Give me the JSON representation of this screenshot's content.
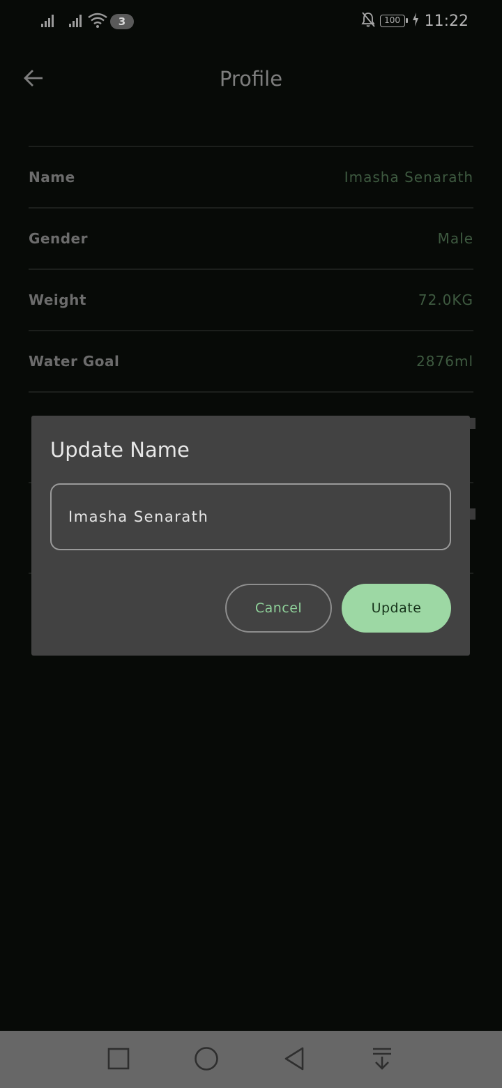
{
  "status_bar": {
    "notification_count": "3",
    "battery_level": "100",
    "time": "11:22",
    "icons": [
      "signal-icon",
      "signal-icon",
      "wifi-icon",
      "bell-off-icon",
      "battery-icon",
      "charging-icon"
    ]
  },
  "app_bar": {
    "title": "Profile",
    "back_icon": "arrow-left-icon"
  },
  "profile": {
    "rows": [
      {
        "label": "Name",
        "value": "Imasha Senarath"
      },
      {
        "label": "Gender",
        "value": "Male"
      },
      {
        "label": "Weight",
        "value": "72.0KG"
      },
      {
        "label": "Water Goal",
        "value": "2876ml"
      }
    ]
  },
  "dialog": {
    "title": "Update Name",
    "field_value": "Imasha Senarath",
    "cancel_label": "Cancel",
    "update_label": "Update"
  },
  "nav_bar": {
    "buttons": [
      "recents-square-icon",
      "home-circle-icon",
      "back-triangle-icon",
      "notification-pull-icon"
    ]
  },
  "colors": {
    "background": "#070a07",
    "dialog": "#424242",
    "accent": "#9dd8a4",
    "value_text": "#3e5a40"
  }
}
